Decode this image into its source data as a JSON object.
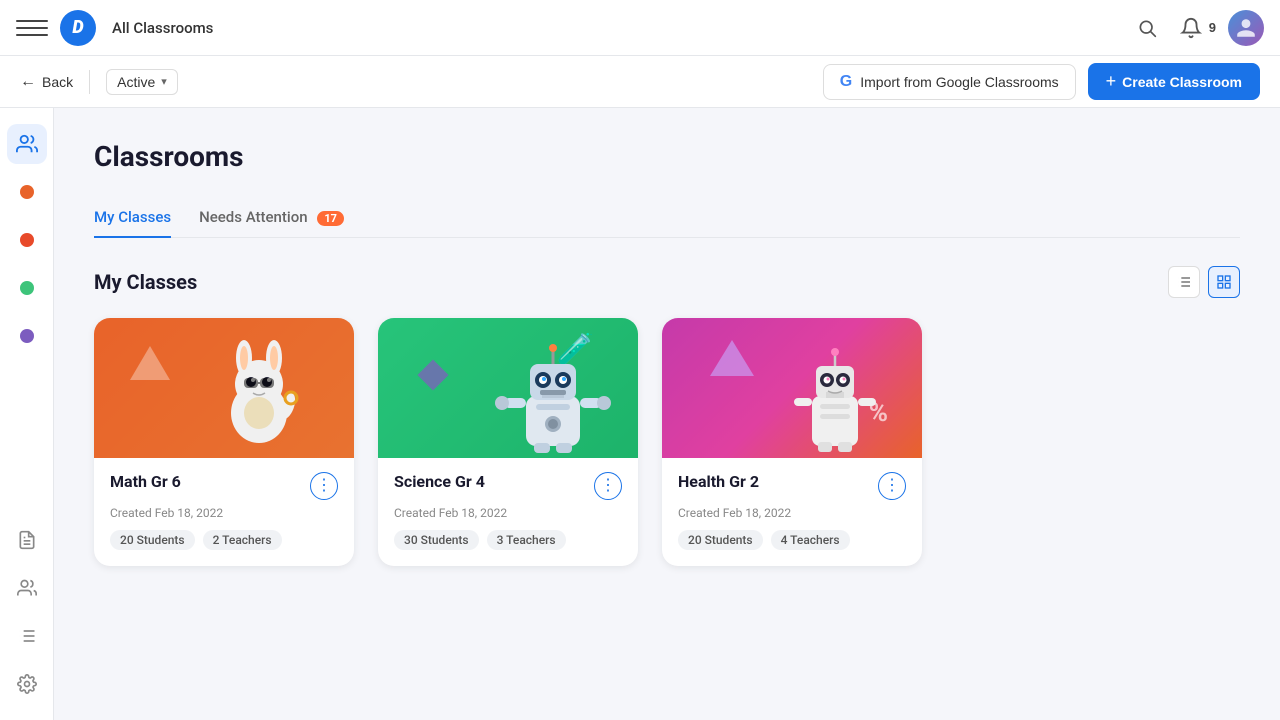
{
  "topNav": {
    "title": "All Classrooms",
    "notifCount": "9"
  },
  "subNav": {
    "backLabel": "Back",
    "activeLabel": "Active",
    "importLabel": "Import from Google Classrooms",
    "createLabel": "Create Classroom",
    "createPlus": "+"
  },
  "sidebar": {
    "dots": [
      {
        "color": "#e8632a"
      },
      {
        "color": "#e84a2a"
      },
      {
        "color": "#3dc47a"
      },
      {
        "color": "#7c5cbf"
      }
    ]
  },
  "page": {
    "title": "Classrooms",
    "tabs": [
      {
        "label": "My Classes",
        "active": true
      },
      {
        "label": "Needs Attention",
        "badge": "17"
      }
    ],
    "myClasses": {
      "sectionTitle": "My Classes",
      "cards": [
        {
          "title": "Math Gr 6",
          "date": "Created Feb 18, 2022",
          "students": "20 Students",
          "teachers": "2 Teachers",
          "theme": "math"
        },
        {
          "title": "Science Gr 4",
          "date": "Created Feb 18, 2022",
          "students": "30 Students",
          "teachers": "3 Teachers",
          "theme": "science"
        },
        {
          "title": "Health Gr 2",
          "date": "Created Feb 18, 2022",
          "students": "20 Students",
          "teachers": "4 Teachers",
          "theme": "health"
        }
      ]
    }
  }
}
